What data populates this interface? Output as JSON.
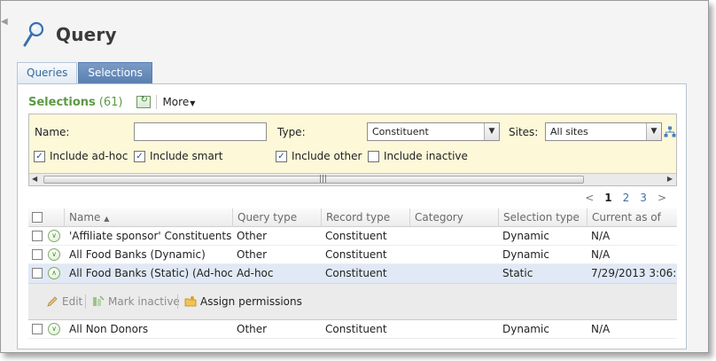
{
  "page": {
    "title": "Query"
  },
  "tabs": [
    {
      "label": "Queries",
      "active": false
    },
    {
      "label": "Selections",
      "active": true
    }
  ],
  "selections": {
    "title": "Selections",
    "count": "(61)",
    "more_label": "More"
  },
  "filters": {
    "name_label": "Name:",
    "name_value": "",
    "type_label": "Type:",
    "type_value": "Constituent",
    "sites_label": "Sites:",
    "sites_value": "All sites",
    "checkboxes": [
      {
        "label": "Include ad-hoc",
        "checked": true
      },
      {
        "label": "Include smart",
        "checked": true
      },
      {
        "label": "Include other",
        "checked": true
      },
      {
        "label": "Include inactive",
        "checked": false
      }
    ]
  },
  "pager": {
    "prev": "<",
    "pages": [
      "1",
      "2",
      "3"
    ],
    "current": "1",
    "next": ">"
  },
  "grid": {
    "columns": [
      "Name",
      "Query type",
      "Record type",
      "Category",
      "Selection type",
      "Current as of"
    ],
    "sort_indicator": "▲",
    "rows": [
      {
        "name": "'Affiliate sponsor' Constituents",
        "query_type": "Other",
        "record_type": "Constituent",
        "category": "",
        "selection_type": "Dynamic",
        "current_as_of": "N/A"
      },
      {
        "name": "All Food Banks (Dynamic)",
        "query_type": "Other",
        "record_type": "Constituent",
        "category": "",
        "selection_type": "Dynamic",
        "current_as_of": "N/A"
      },
      {
        "name": "All Food Banks (Static) (Ad-hoc ...",
        "query_type": "Ad-hoc",
        "record_type": "Constituent",
        "category": "",
        "selection_type": "Static",
        "current_as_of": "7/29/2013 3:06:..."
      },
      {
        "name": "All Non Donors",
        "query_type": "Other",
        "record_type": "Constituent",
        "category": "",
        "selection_type": "Dynamic",
        "current_as_of": "N/A"
      }
    ],
    "actions": [
      {
        "label": "Edit",
        "enabled": false
      },
      {
        "label": "Mark inactive",
        "enabled": false
      },
      {
        "label": "Assign permissions",
        "enabled": true
      }
    ]
  },
  "colors": {
    "accent_green": "#5d9a43",
    "filter_bg": "#fcf8d8",
    "tab_active": "#5a7fb0",
    "selected_row": "#e0e9f5"
  }
}
